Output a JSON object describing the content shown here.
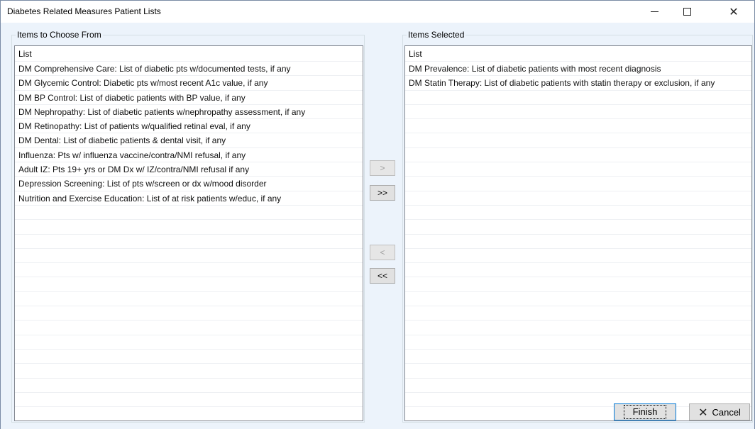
{
  "window": {
    "title": "Diabetes Related Measures Patient Lists"
  },
  "left_group": {
    "label": "Items to Choose From",
    "list_header": "List",
    "items": [
      "DM Comprehensive Care: List of diabetic pts w/documented tests, if any",
      "DM Glycemic Control: Diabetic pts w/most recent A1c value, if any",
      "DM BP Control: List of diabetic patients with BP value, if any",
      "DM Nephropathy: List of diabetic patients w/nephropathy assessment, if any",
      "DM Retinopathy: List of patients w/qualified retinal eval, if any",
      "DM Dental: List of diabetic patients & dental visit, if any",
      "Influenza: Pts w/ influenza vaccine/contra/NMI refusal, if any",
      "Adult IZ: Pts 19+ yrs or DM Dx w/ IZ/contra/NMI refusal if any",
      "Depression Screening: List of pts w/screen or dx w/mood disorder",
      "Nutrition and Exercise Education: List of at risk patients w/educ, if any"
    ]
  },
  "right_group": {
    "label": "Items Selected",
    "list_header": "List",
    "items": [
      "DM Prevalence: List of diabetic patients with most recent diagnosis",
      "DM Statin Therapy: List of diabetic patients with statin therapy or exclusion, if any"
    ]
  },
  "buttons": {
    "add": ">",
    "add_all": ">>",
    "remove": "<",
    "remove_all": "<<",
    "finish": "Finish",
    "cancel": "Cancel"
  },
  "icons": {
    "minimize": "minimize-icon",
    "maximize": "maximize-icon",
    "close": "close-icon",
    "cancel": "x-icon"
  }
}
